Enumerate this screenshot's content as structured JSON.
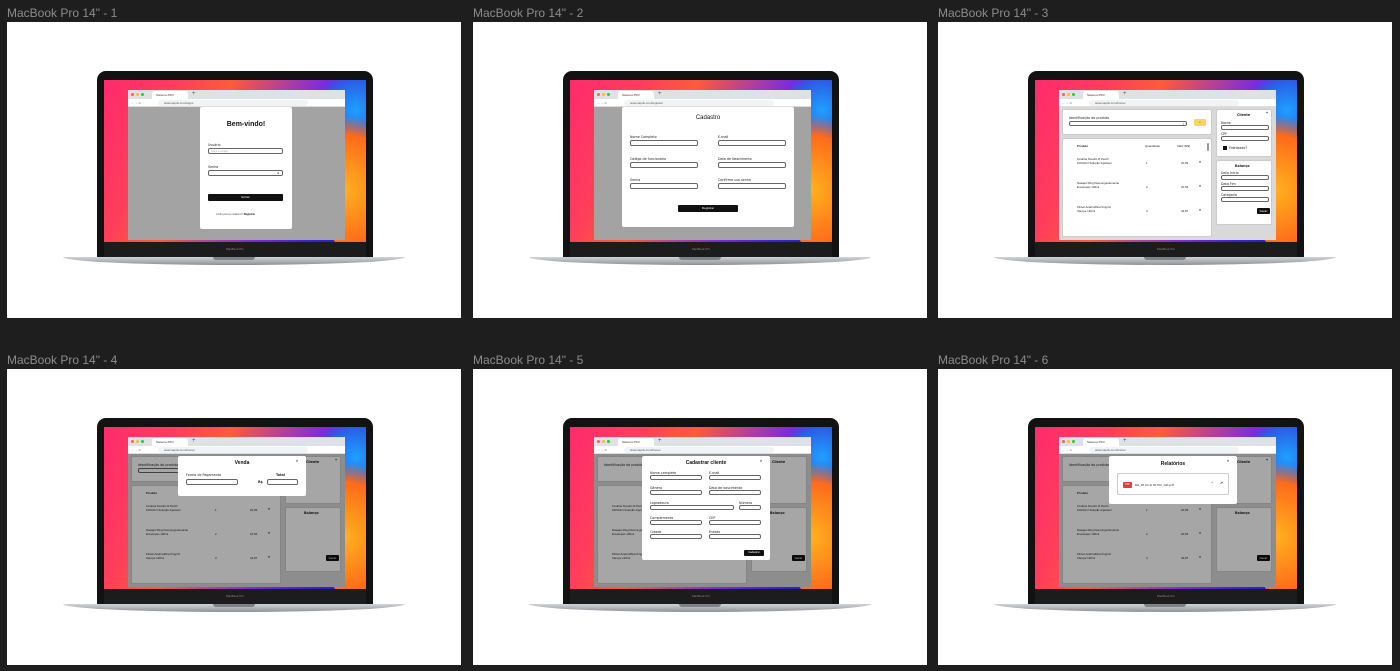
{
  "frames": [
    {
      "title": "MacBook Pro 14\" - 1"
    },
    {
      "title": "MacBook Pro 14\" - 2"
    },
    {
      "title": "MacBook Pro 14\" - 3"
    },
    {
      "title": "MacBook Pro 14\" - 4"
    },
    {
      "title": "MacBook Pro 14\" - 5"
    },
    {
      "title": "MacBook Pro 14\" - 6"
    }
  ],
  "browser": {
    "tab_title": "Sistema PDV",
    "chin_label": "MacBook Pro"
  },
  "urls": {
    "login": "sistemapdv.com/login/",
    "register": "sistemapdv.com/register/",
    "home": "sistemapdv.com/home/"
  },
  "login": {
    "title": "Bem-vindo!",
    "user_label": "Usuário",
    "user_placeholder": "Insira o código",
    "pass_label": "Senha",
    "submit": "Entrar",
    "footer_text": "Ainda possui cadastro?",
    "footer_link": "Registrar"
  },
  "register": {
    "title": "Cadastro",
    "name_label": "Nome Completo",
    "email_label": "E-mail",
    "code_label": "Código de funcionário",
    "birth_label": "Data de Nascimento",
    "pass_label": "Senha",
    "confirm_label": "Confirma sua senha",
    "submit": "Registrar"
  },
  "home": {
    "product_id_label": "Identificação do produto",
    "col_product": "Produto",
    "col_qty": "Quantidade",
    "col_value": "Valor (R$)",
    "products": [
      {
        "name1": "Insulina Novolin R Penfil",
        "name2": "100UI/ml Solução Injetável",
        "qty": "1",
        "value": "20,99"
      },
      {
        "name1": "Nasajet Ring Descongestionante",
        "name2": "Envelopes 100ml",
        "qty": "2",
        "value": "20,56"
      },
      {
        "name1": "Filinar Acebrofilina 5mg/ml",
        "name2": "Xarope 120ml",
        "qty": "3",
        "value": "42,87"
      }
    ],
    "client_title": "Cliente",
    "client_name_label": "Nome",
    "client_cpf_label": "CPF",
    "loyalty_label": "Fidelizado?",
    "balance_title": "Balanço",
    "start_date_label": "Data Início",
    "end_date_label": "Data Fim",
    "category_label": "Categoria",
    "generate_button": "Gerar"
  },
  "sale_modal": {
    "title": "Venda",
    "payment_label": "Forma de Pagamento",
    "total_label": "Total",
    "currency": "R$"
  },
  "client_modal": {
    "title": "Cadastrar cliente",
    "name_label": "Nome completo",
    "email_label": "E-mail",
    "gender_label": "Gênero",
    "birth_label": "Data de nascimento",
    "street_label": "Logradouro",
    "number_label": "Número",
    "complement_label": "Complemento",
    "cep_label": "CEP",
    "city_label": "Cidade",
    "state_label": "Estado",
    "submit": "Cadastrar"
  },
  "reports_modal": {
    "title": "Relatórios",
    "file_badge": "PDF",
    "file_name": "Rel_Dt Inicio Dt Fim_Cat.pdf"
  }
}
